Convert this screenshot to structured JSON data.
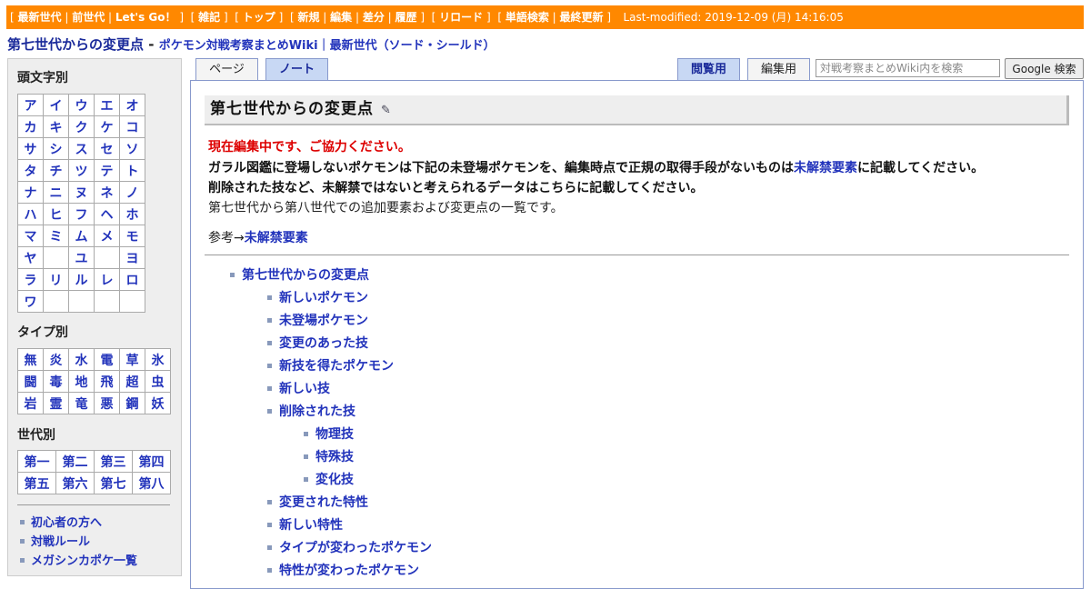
{
  "topbar": {
    "g1": [
      "最新世代",
      "前世代",
      "Let's Go！"
    ],
    "g2": [
      "雑記"
    ],
    "g3": [
      "トップ"
    ],
    "g4": [
      "新規",
      "編集",
      "差分",
      "履歴"
    ],
    "g5": [
      "リロード"
    ],
    "g6": [
      "単語検索",
      "最終更新"
    ],
    "last_modified": "Last-modified: 2019-12-09 (月) 14:16:05"
  },
  "header": {
    "page_title": "第七世代からの変更点",
    "dash": " - ",
    "subtitle": "ポケモン対戦考察まとめWiki｜最新世代（ソード・シールド）"
  },
  "tabs": {
    "page": "ページ",
    "note": "ノート",
    "view": "閲覧用",
    "edit": "編集用"
  },
  "search": {
    "placeholder": "対戦考察まとめWiki内を検索",
    "button": "Google 検索"
  },
  "sidebar": {
    "kana_heading": "頭文字別",
    "kana": [
      [
        "ア",
        "イ",
        "ウ",
        "エ",
        "オ"
      ],
      [
        "カ",
        "キ",
        "ク",
        "ケ",
        "コ"
      ],
      [
        "サ",
        "シ",
        "ス",
        "セ",
        "ソ"
      ],
      [
        "タ",
        "チ",
        "ツ",
        "テ",
        "ト"
      ],
      [
        "ナ",
        "ニ",
        "ヌ",
        "ネ",
        "ノ"
      ],
      [
        "ハ",
        "ヒ",
        "フ",
        "ヘ",
        "ホ"
      ],
      [
        "マ",
        "ミ",
        "ム",
        "メ",
        "モ"
      ],
      [
        "ヤ",
        "",
        "ユ",
        "",
        "ヨ"
      ],
      [
        "ラ",
        "リ",
        "ル",
        "レ",
        "ロ"
      ],
      [
        "ワ",
        "",
        "",
        "",
        ""
      ]
    ],
    "type_heading": "タイプ別",
    "types": [
      [
        "無",
        "炎",
        "水",
        "電",
        "草",
        "氷"
      ],
      [
        "闘",
        "毒",
        "地",
        "飛",
        "超",
        "虫"
      ],
      [
        "岩",
        "霊",
        "竜",
        "悪",
        "鋼",
        "妖"
      ]
    ],
    "gen_heading": "世代別",
    "gens": [
      [
        "第一",
        "第二",
        "第三",
        "第四"
      ],
      [
        "第五",
        "第六",
        "第七",
        "第八"
      ]
    ],
    "links": [
      "初心者の方へ",
      "対戦ルール",
      "メガシンカポケ一覧"
    ]
  },
  "main": {
    "title": "第七世代からの変更点",
    "edit_icon": "pencil-icon",
    "notice_red": "現在編集中です、ご協力ください。",
    "line2_pre": "ガラル図鑑に登場しないポケモンは下記の未登場ポケモンを、編集時点で正規の取得手段がないものは",
    "line2_link": "未解禁要素",
    "line2_post": "に記載してください。",
    "line3": "削除された技など、未解禁ではないと考えられるデータはこちらに記載してください。",
    "line4": "第七世代から第八世代での追加要素および変更点の一覧です。",
    "ref_prefix": "参考→",
    "ref_link": "未解禁要素",
    "toc": [
      {
        "label": "第七世代からの変更点",
        "level": 0
      },
      {
        "label": "新しいポケモン",
        "level": 1
      },
      {
        "label": "未登場ポケモン",
        "level": 1
      },
      {
        "label": "変更のあった技",
        "level": 1
      },
      {
        "label": "新技を得たポケモン",
        "level": 1
      },
      {
        "label": "新しい技",
        "level": 1
      },
      {
        "label": "削除された技",
        "level": 1
      },
      {
        "label": "物理技",
        "level": 2
      },
      {
        "label": "特殊技",
        "level": 2
      },
      {
        "label": "変化技",
        "level": 2
      },
      {
        "label": "変更された特性",
        "level": 1
      },
      {
        "label": "新しい特性",
        "level": 1
      },
      {
        "label": "タイプが変わったポケモン",
        "level": 1
      },
      {
        "label": "特性が変わったポケモン",
        "level": 1
      }
    ]
  },
  "colors": {
    "topbar_bg": "#ff8800",
    "link": "#2233bb",
    "notice": "#dd0000",
    "tab_active": "#c8d8f4"
  }
}
